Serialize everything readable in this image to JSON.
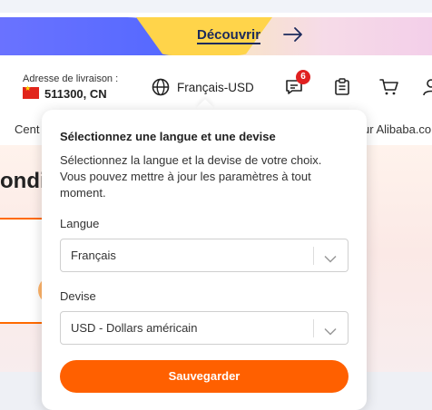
{
  "promo": {
    "link_label": "Découvrir"
  },
  "header": {
    "delivery_label": "Adresse de livraison :",
    "delivery_value": "511300, CN",
    "language_currency": "Français-USD",
    "message_badge": "6"
  },
  "nav": {
    "left_partial": "Cent",
    "right_partial": "ur Alibaba.co"
  },
  "page": {
    "heading_partial": "ondi"
  },
  "popover": {
    "title": "Sélectionnez une langue et une devise",
    "description": "Sélectionnez la langue et la devise de votre choix. Vous pouvez mettre à jour les paramètres à tout moment.",
    "language_label": "Langue",
    "language_value": "Français",
    "currency_label": "Devise",
    "currency_value": "USD - Dollars américain",
    "save_label": "Sauvegarder"
  },
  "colors": {
    "accent": "#ff6000",
    "badge": "#e02020",
    "promo_text": "#1b2a5c"
  },
  "icons": [
    "globe-icon",
    "message-icon",
    "clipboard-icon",
    "cart-icon",
    "user-icon",
    "arrow-right-icon",
    "chevron-down-icon"
  ]
}
